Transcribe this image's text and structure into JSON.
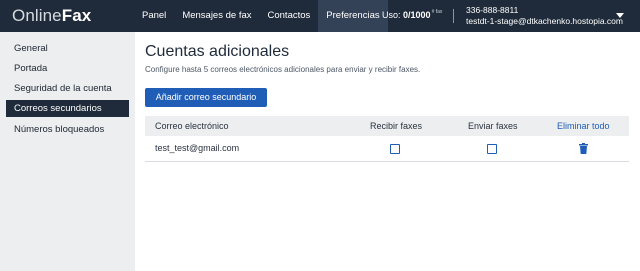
{
  "brand": {
    "part1": "Online",
    "part2": "Fax"
  },
  "nav": {
    "items": [
      {
        "label": "Panel",
        "active": false
      },
      {
        "label": "Mensajes de fax",
        "active": false
      },
      {
        "label": "Contactos",
        "active": false
      },
      {
        "label": "Preferencias",
        "active": true
      }
    ]
  },
  "usage": {
    "label": "Uso:",
    "value": "0/1000",
    "unit": "# fax"
  },
  "account": {
    "phone": "336-888-8811",
    "email": "testdt-1-stage@dtkachenko.hostopia.com",
    "menu_icon": "caret-down-icon"
  },
  "sidebar": {
    "items": [
      {
        "label": "General",
        "active": false
      },
      {
        "label": "Portada",
        "active": false
      },
      {
        "label": "Seguridad de la cuenta",
        "active": false
      },
      {
        "label": "Correos secundarios",
        "active": true
      },
      {
        "label": "Números bloqueados",
        "active": false
      }
    ]
  },
  "main": {
    "title": "Cuentas adicionales",
    "subtitle": "Configure hasta 5 correos electrónicos adicionales para enviar y recibir faxes.",
    "add_button": "Añadir correo secundario",
    "table": {
      "headers": {
        "email": "Correo electrónico",
        "receive": "Recibir faxes",
        "send": "Enviar faxes",
        "delete_all": "Eliminar todo"
      },
      "rows": [
        {
          "email": "test_test@gmail.com",
          "receive": false,
          "send": false,
          "delete_icon": "trash-icon"
        }
      ]
    }
  },
  "colors": {
    "topbar": "#1f2b3a",
    "accent": "#1f5db7",
    "sidebar_bg": "#eceef0"
  }
}
